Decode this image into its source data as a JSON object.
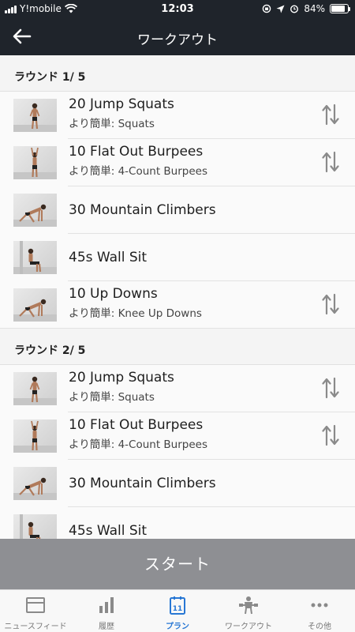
{
  "status": {
    "carrier": "Y!mobile",
    "time": "12:03",
    "battery": "84%",
    "battery_level": 0.84
  },
  "header": {
    "title": "ワークアウト"
  },
  "rounds": [
    {
      "label": "ラウンド 1/ 5",
      "exercises": [
        {
          "name": "20 Jump Squats",
          "easier": "より簡単: Squats",
          "swappable": true,
          "pose": "stand"
        },
        {
          "name": "10 Flat Out Burpees",
          "easier": "より簡単: 4-Count Burpees",
          "swappable": true,
          "pose": "reach"
        },
        {
          "name": "30 Mountain Climbers",
          "easier": "",
          "swappable": false,
          "pose": "plank"
        },
        {
          "name": "45s Wall Sit",
          "easier": "",
          "swappable": false,
          "pose": "sit"
        },
        {
          "name": "10 Up Downs",
          "easier": "より簡単: Knee Up Downs",
          "swappable": true,
          "pose": "plank"
        }
      ]
    },
    {
      "label": "ラウンド 2/ 5",
      "exercises": [
        {
          "name": "20 Jump Squats",
          "easier": "より簡単: Squats",
          "swappable": true,
          "pose": "stand"
        },
        {
          "name": "10 Flat Out Burpees",
          "easier": "より簡単: 4-Count Burpees",
          "swappable": true,
          "pose": "reach"
        },
        {
          "name": "30 Mountain Climbers",
          "easier": "",
          "swappable": false,
          "pose": "plank"
        },
        {
          "name": "45s Wall Sit",
          "easier": "",
          "swappable": false,
          "pose": "sit"
        }
      ]
    }
  ],
  "start_label": "スタート",
  "tabs": [
    {
      "label": "ニュースフィード",
      "icon": "newsfeed-icon",
      "active": false
    },
    {
      "label": "履歴",
      "icon": "history-chart-icon",
      "active": false
    },
    {
      "label": "プラン",
      "icon": "calendar-icon",
      "active": true,
      "badge": "11"
    },
    {
      "label": "ワークアウト",
      "icon": "workout-icon",
      "active": false
    },
    {
      "label": "その他",
      "icon": "more-icon",
      "active": false
    }
  ],
  "colors": {
    "header_bg": "#1f242b",
    "accent": "#2877d4",
    "start_bg": "#8e8f93"
  }
}
